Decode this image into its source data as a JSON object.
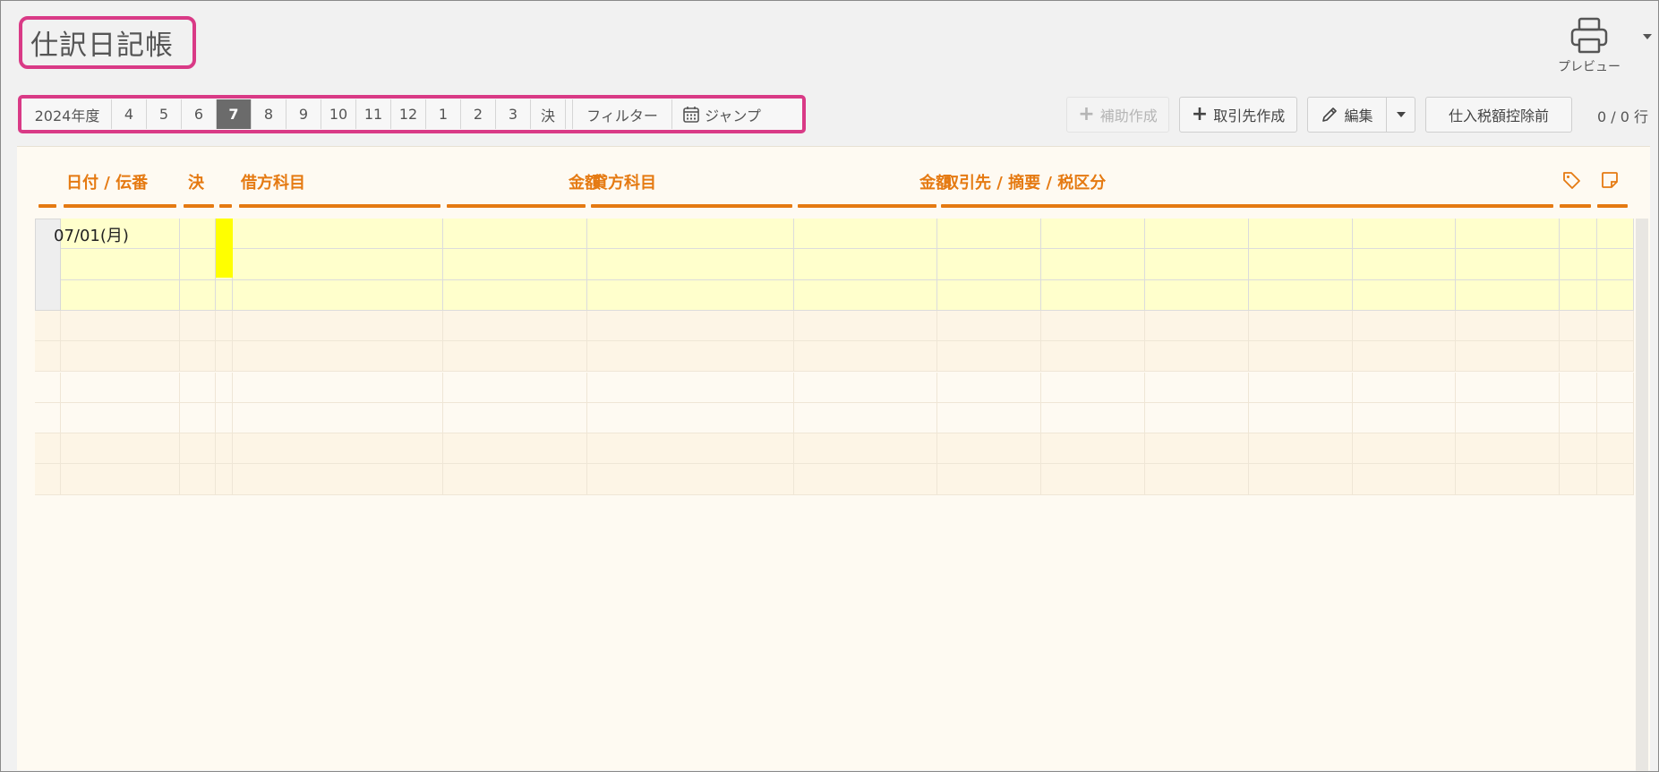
{
  "header": {
    "title": "仕訳日記帳",
    "preview_label": "プレビュー"
  },
  "month_bar": {
    "year_label": "2024年度",
    "months": [
      "4",
      "5",
      "6",
      "7",
      "8",
      "9",
      "10",
      "11",
      "12",
      "1",
      "2",
      "3",
      "決"
    ],
    "active_month": "7",
    "filter_label": "フィルター",
    "jump_label": "ジャンプ"
  },
  "toolbar": {
    "aux_create_label": "補助作成",
    "partner_create_label": "取引先作成",
    "edit_label": "編集",
    "tax_label": "仕入税額控除前",
    "row_count": "0 / 0 行"
  },
  "columns": {
    "date": "日付 / 伝番",
    "settle": "決",
    "debit_account": "借方科目",
    "debit_amount": "金額",
    "credit_account": "貸方科目",
    "credit_amount": "金額",
    "partner": "取引先 / 摘要 / 税区分"
  },
  "rows": [
    {
      "date": "07/01(月)"
    }
  ],
  "colors": {
    "accent": "#e57a12",
    "highlight": "#d93a86",
    "row_bg": "#ffffcc",
    "marker": "#ffff00"
  }
}
